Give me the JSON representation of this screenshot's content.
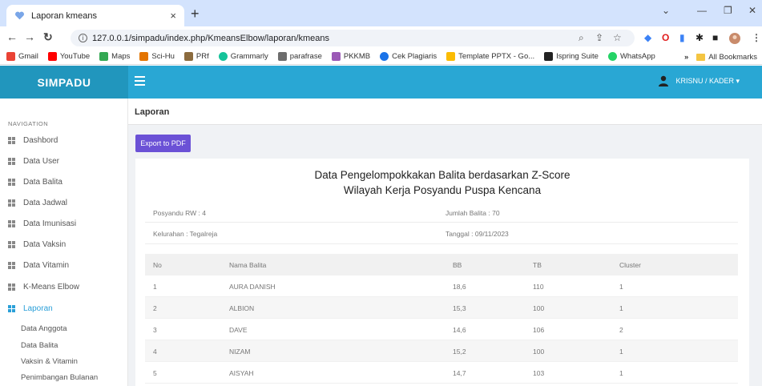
{
  "browser": {
    "tab_title": "Laporan kmeans",
    "tab_close": "×",
    "new_tab": "+",
    "url": "127.0.0.1/simpadu/index.php/KmeansElbow/laporan/kmeans",
    "bookmarks": [
      {
        "label": "Gmail",
        "color": "#ea4335"
      },
      {
        "label": "YouTube",
        "color": "#ff0000"
      },
      {
        "label": "Maps",
        "color": "#34a853"
      },
      {
        "label": "Sci-Hu",
        "color": "#e37400"
      },
      {
        "label": "PRf",
        "color": "#8b6b3e"
      },
      {
        "label": "Grammarly",
        "color": "#15c39a"
      },
      {
        "label": "parafrase",
        "color": "#6d6d6d"
      },
      {
        "label": "PKKMB",
        "color": "#9b59b6"
      },
      {
        "label": "Cek Plagiaris",
        "color": "#1a73e8"
      },
      {
        "label": "Template PPTX - Go...",
        "color": "#fbbc04"
      },
      {
        "label": "Ispring Suite",
        "color": "#222222"
      },
      {
        "label": "WhatsApp",
        "color": "#25d366"
      }
    ],
    "bookmarks_more": "»",
    "all_bookmarks": "All Bookmarks"
  },
  "app": {
    "brand": "SIMPADU",
    "user_label": "KRISNU / KADER ▾",
    "colors": {
      "brand": "#2196bd",
      "header": "#29a7d4",
      "accent": "#6b51d6",
      "active": "#2a9fd8"
    }
  },
  "sidebar": {
    "heading": "NAVIGATION",
    "items": [
      {
        "label": "Dashbord"
      },
      {
        "label": "Data User"
      },
      {
        "label": "Data Balita"
      },
      {
        "label": "Data Jadwal"
      },
      {
        "label": "Data Imunisasi"
      },
      {
        "label": "Data Vaksin"
      },
      {
        "label": "Data Vitamin"
      },
      {
        "label": "K-Means Elbow"
      },
      {
        "label": "Laporan"
      }
    ],
    "sub_items": [
      {
        "label": "Data Anggota"
      },
      {
        "label": "Data Balita"
      },
      {
        "label": "Vaksin & Vitamin"
      },
      {
        "label": "Penimbangan Bulanan"
      }
    ]
  },
  "main": {
    "page_title": "Laporan",
    "export_button": "Export to PDF",
    "report_title_1": "Data Pengelompokkakan Balita berdasarkan Z-Score",
    "report_title_2": "Wilayah Kerja Posyandu Puspa Kencana",
    "posyandu": "Posyandu RW : 4",
    "jumlah": "Jumlah Balita : 70",
    "kelurahan": "Kelurahan : Tegalreja",
    "tanggal": "Tanggal : 09/11/2023",
    "table": {
      "headers": {
        "no": "No",
        "nama": "Nama Balita",
        "bb": "BB",
        "tb": "TB",
        "cluster": "Cluster"
      },
      "rows": [
        {
          "no": "1",
          "nama": "AURA DANISH",
          "bb": "18,6",
          "tb": "110",
          "cluster": "1"
        },
        {
          "no": "2",
          "nama": "ALBION",
          "bb": "15,3",
          "tb": "100",
          "cluster": "1"
        },
        {
          "no": "3",
          "nama": "DAVE",
          "bb": "14,6",
          "tb": "106",
          "cluster": "2"
        },
        {
          "no": "4",
          "nama": "NIZAM",
          "bb": "15,2",
          "tb": "100",
          "cluster": "1"
        },
        {
          "no": "5",
          "nama": "AISYAH",
          "bb": "14,7",
          "tb": "103",
          "cluster": "1"
        }
      ]
    }
  }
}
